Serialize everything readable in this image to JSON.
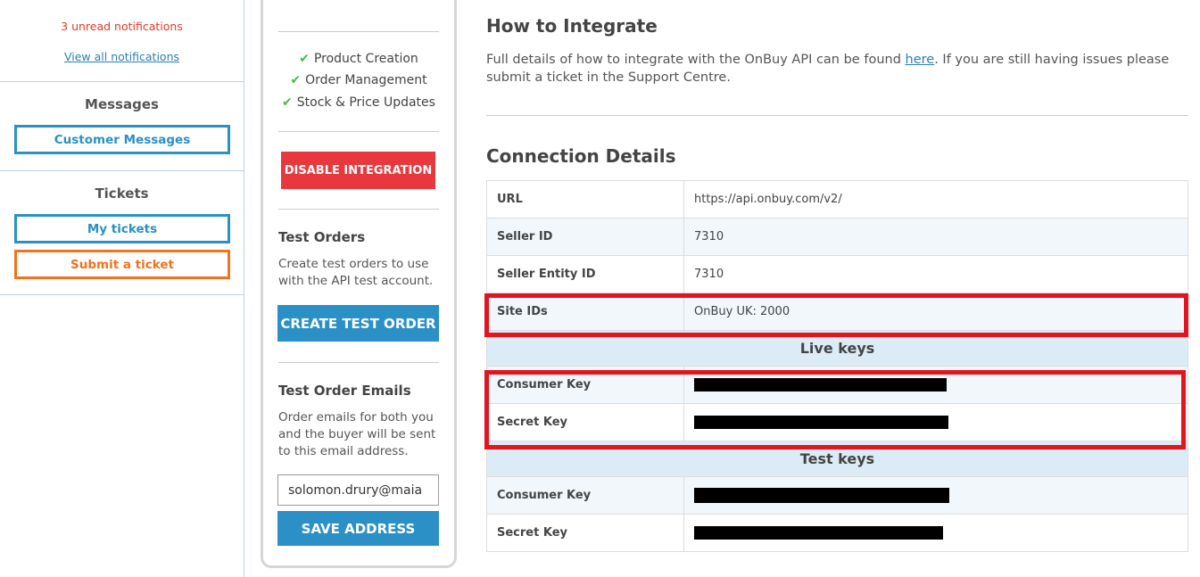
{
  "sidebar": {
    "unread_notifications": "3 unread notifications",
    "view_all_link": "View all notifications",
    "messages_heading": "Messages",
    "customer_messages_button": "Customer Messages",
    "tickets_heading": "Tickets",
    "my_tickets_button": "My tickets",
    "submit_ticket_button": "Submit a ticket"
  },
  "integration": {
    "features": [
      "Product Creation",
      "Order Management",
      "Stock & Price Updates"
    ],
    "disable_button": "DISABLE INTEGRATION",
    "test_orders_heading": "Test Orders",
    "test_orders_text": "Create test orders to use with the API test account.",
    "create_test_order_button": "CREATE TEST ORDER",
    "test_emails_heading": "Test Order Emails",
    "test_emails_text": "Order emails for both you and the buyer will be sent to this email address.",
    "email_value": "solomon.drury@maia",
    "save_address_button": "SAVE ADDRESS"
  },
  "main": {
    "how_heading": "How to Integrate",
    "intro_before_link": "Full details of how to integrate with the OnBuy API can be found ",
    "intro_link": "here",
    "intro_after_link": ". If you are still having issues please submit a ticket in the Support Centre.",
    "connection_heading": "Connection Details",
    "details": [
      {
        "label": "URL",
        "value": "https://api.onbuy.com/v2/"
      },
      {
        "label": "Seller ID",
        "value": "7310"
      },
      {
        "label": "Seller Entity ID",
        "value": "7310"
      },
      {
        "label": "Site IDs",
        "value": "OnBuy UK: 2000"
      }
    ],
    "live_keys_heading": "Live keys",
    "live_keys": [
      {
        "label": "Consumer Key"
      },
      {
        "label": "Secret Key"
      }
    ],
    "test_keys_heading": "Test keys",
    "test_keys": [
      {
        "label": "Consumer Key"
      },
      {
        "label": "Secret Key"
      }
    ]
  },
  "colors": {
    "accent_blue": "#2a90c5",
    "orange": "#f0731e",
    "danger_red": "#e8383d",
    "check_green": "#4cb848",
    "highlight_red": "#e3141e"
  }
}
